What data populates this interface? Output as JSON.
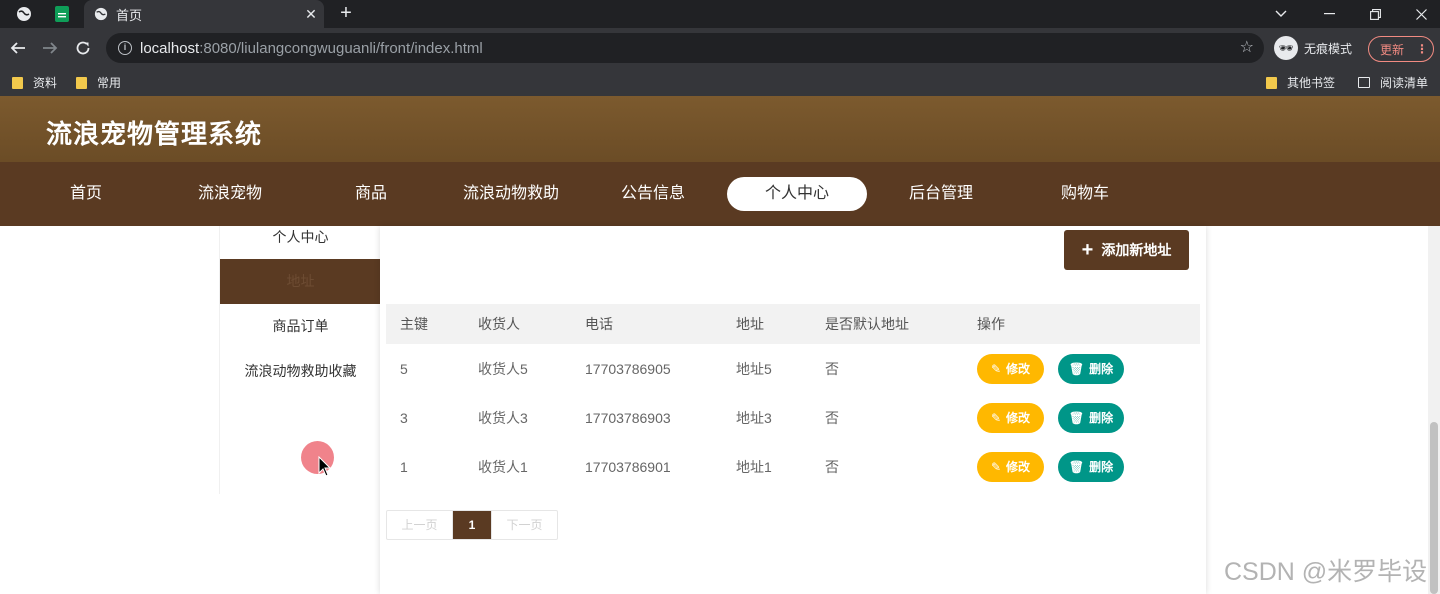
{
  "browser": {
    "tab_title": "首页",
    "tab_close": "✕",
    "new_tab": "+",
    "url_host": "localhost",
    "url_path": ":8080/liulangcongwuguanli/front/index.html",
    "incognito_label": "无痕模式",
    "update_label": "更新",
    "bookmarks": [
      "资料",
      "常用"
    ],
    "bookmarks_right": [
      "其他书签",
      "阅读清单"
    ]
  },
  "site": {
    "title": "流浪宠物管理系统",
    "nav": [
      "首页",
      "流浪宠物",
      "商品",
      "流浪动物救助",
      "公告信息",
      "个人中心",
      "后台管理",
      "购物车"
    ],
    "active_nav": "个人中心"
  },
  "sidebar": {
    "items": [
      "个人中心",
      "地址",
      "商品订单",
      "流浪动物救助收藏"
    ],
    "active_index": 1
  },
  "main": {
    "add_button": "添加新地址",
    "columns": [
      "主键",
      "收货人",
      "电话",
      "地址",
      "是否默认地址",
      "操作"
    ],
    "rows": [
      {
        "id": "5",
        "receiver": "收货人5",
        "phone": "17703786905",
        "address": "地址5",
        "is_default": "否"
      },
      {
        "id": "3",
        "receiver": "收货人3",
        "phone": "17703786903",
        "address": "地址3",
        "is_default": "否"
      },
      {
        "id": "1",
        "receiver": "收货人1",
        "phone": "17703786901",
        "address": "地址1",
        "is_default": "否"
      }
    ],
    "edit_label": "修改",
    "delete_label": "删除",
    "pager": {
      "prev": "上一页",
      "current": "1",
      "next": "下一页"
    }
  },
  "watermark": "CSDN @米罗毕设",
  "colors": {
    "brand_dark": "#5a3a22",
    "brand_header": "#7c5a2e",
    "edit": "#ffb800",
    "delete": "#009688"
  }
}
